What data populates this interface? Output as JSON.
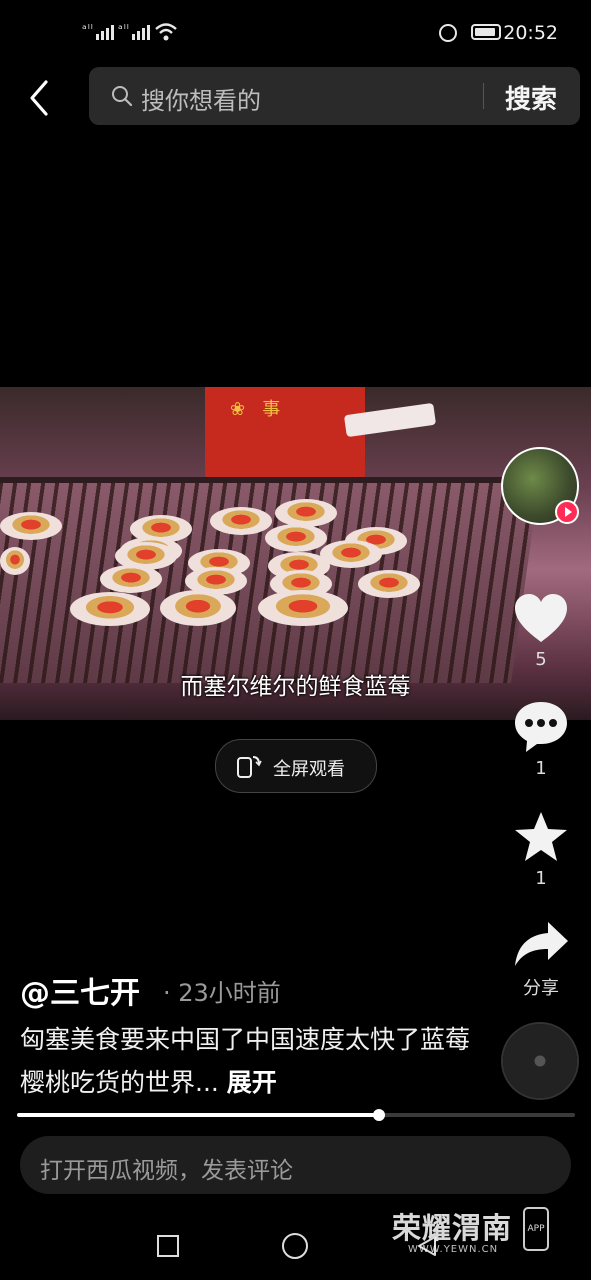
{
  "status_bar": {
    "signal_1": "⁴⁶",
    "signal_2": "⁴⁶",
    "time": "20:52"
  },
  "header": {
    "search_placeholder": "搜你想看的",
    "search_button": "搜索"
  },
  "video": {
    "subtitle": "而塞尔维尔的鲜食蓝莓",
    "fullscreen_label": "全屏观看"
  },
  "actions": {
    "like_count": "5",
    "comment_count": "1",
    "favorite_count": "1",
    "share_label": "分享"
  },
  "post": {
    "author": "@三七开",
    "time_ago": "· 23小时前",
    "description": "匈塞美食要来中国了中国速度太快了蓝莓樱桃吃货的世界...",
    "expand_label": "展开"
  },
  "playback": {
    "progress": 0.649
  },
  "comment_box": {
    "placeholder": "打开西瓜视频，发表评论"
  },
  "watermark": {
    "brand": "荣耀渭南",
    "url": "WWW.YEWN.CN",
    "app_label": "APP"
  }
}
